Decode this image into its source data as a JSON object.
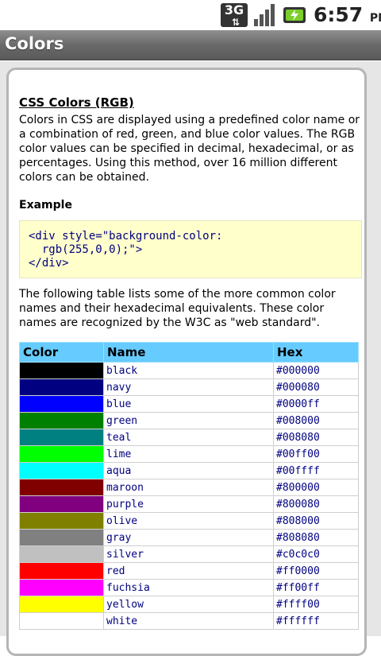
{
  "status_bar": {
    "network": "3G",
    "time": "6:57",
    "ampm": "PM"
  },
  "titlebar": {
    "title": "Colors"
  },
  "article": {
    "heading": "CSS Colors (RGB)",
    "intro": "Colors in CSS are displayed using a predefined color name or a combination of red, green, and blue color values. The RGB color values can be specified in decimal, hexadecimal, or as percentages. Using this method, over 16 million different colors can be obtained.",
    "example_heading": "Example",
    "example_code": "<div style=\"background-color:\n  rgb(255,0,0);\">\n</div>",
    "table_intro": "The following table lists some of the more common color names and their hexadecimal equivalents. These color names are recognized by the W3C as \"web standard\".",
    "table": {
      "headers": [
        "Color",
        "Name",
        "Hex"
      ],
      "rows": [
        {
          "name": "black",
          "hex": "#000000",
          "swatch": "#000000"
        },
        {
          "name": "navy",
          "hex": "#000080",
          "swatch": "#000080"
        },
        {
          "name": "blue",
          "hex": "#0000ff",
          "swatch": "#0000ff"
        },
        {
          "name": "green",
          "hex": "#008000",
          "swatch": "#008000"
        },
        {
          "name": "teal",
          "hex": "#008080",
          "swatch": "#008080"
        },
        {
          "name": "lime",
          "hex": "#00ff00",
          "swatch": "#00ff00"
        },
        {
          "name": "aqua",
          "hex": "#00ffff",
          "swatch": "#00ffff"
        },
        {
          "name": "maroon",
          "hex": "#800000",
          "swatch": "#800000"
        },
        {
          "name": "purple",
          "hex": "#800080",
          "swatch": "#800080"
        },
        {
          "name": "olive",
          "hex": "#808000",
          "swatch": "#808000"
        },
        {
          "name": "gray",
          "hex": "#808080",
          "swatch": "#808080"
        },
        {
          "name": "silver",
          "hex": "#c0c0c0",
          "swatch": "#c0c0c0"
        },
        {
          "name": "red",
          "hex": "#ff0000",
          "swatch": "#ff0000"
        },
        {
          "name": "fuchsia",
          "hex": "#ff00ff",
          "swatch": "#ff00ff"
        },
        {
          "name": "yellow",
          "hex": "#ffff00",
          "swatch": "#ffff00"
        },
        {
          "name": "white",
          "hex": "#ffffff",
          "swatch": "#ffffff"
        }
      ]
    }
  },
  "colors": {
    "header_bg": "#66ccff",
    "example_bg": "#ffffcc",
    "code_text": "#000080"
  }
}
